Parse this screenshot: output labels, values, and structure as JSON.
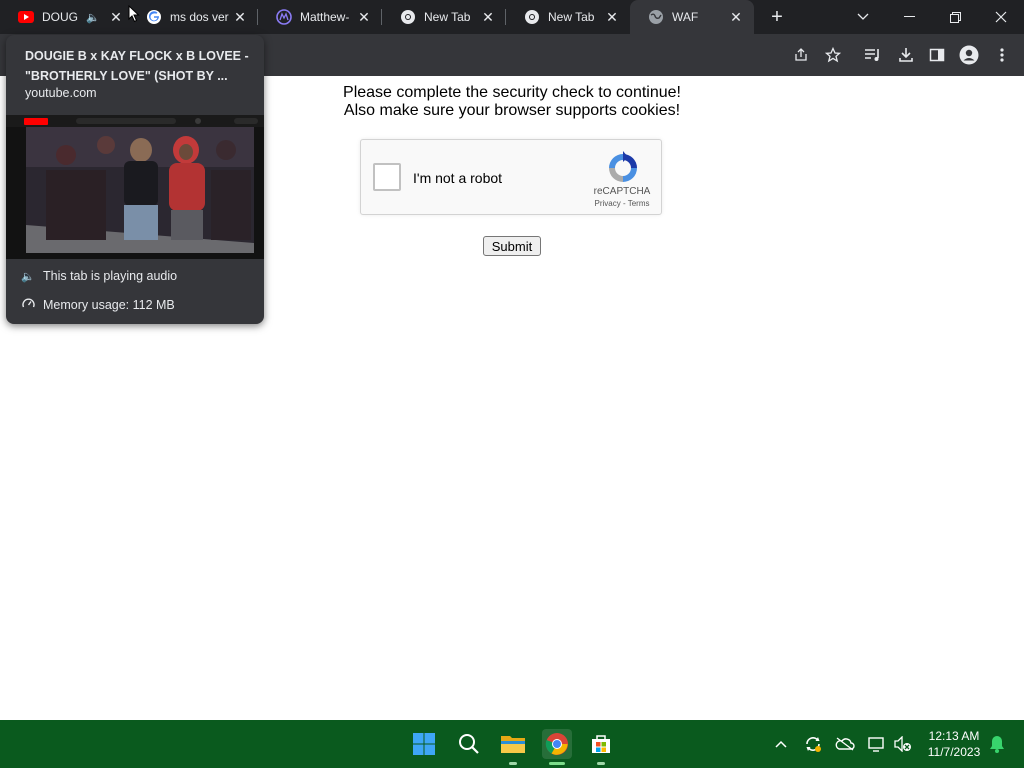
{
  "tabs": [
    {
      "title": "DOUG",
      "favicon": "youtube-icon",
      "playing_audio": true,
      "active": false
    },
    {
      "title": "ms dos ver",
      "favicon": "google-icon",
      "active": false
    },
    {
      "title": "Matthew-",
      "favicon": "app-icon",
      "active": false
    },
    {
      "title": "New Tab",
      "favicon": "chrome-icon",
      "active": false
    },
    {
      "title": "New Tab",
      "favicon": "chrome-icon",
      "active": false
    },
    {
      "title": "WAF",
      "favicon": "globe-icon",
      "active": true
    }
  ],
  "page": {
    "line1": "Please complete the security check to continue!",
    "line2": "Also make sure your browser supports cookies!",
    "captcha": {
      "label": "I'm not a robot",
      "brand": "reCAPTCHA",
      "links": "Privacy - Terms"
    },
    "submit_label": "Submit"
  },
  "hover_card": {
    "title": "DOUGIE B x KAY FLOCK x B LOVEE - \"BROTHERLY LOVE\" (SHOT BY ...",
    "domain": "youtube.com",
    "audio_status": "This tab is playing audio",
    "memory": "Memory usage: 112 MB"
  },
  "taskbar": {
    "time": "12:13 AM",
    "date": "11/7/2023"
  },
  "colors": {
    "tabstrip": "#202124",
    "toolbar": "#35363a",
    "taskbar": "#0a5a1e",
    "recaptcha_blue": "#4a90e2"
  }
}
